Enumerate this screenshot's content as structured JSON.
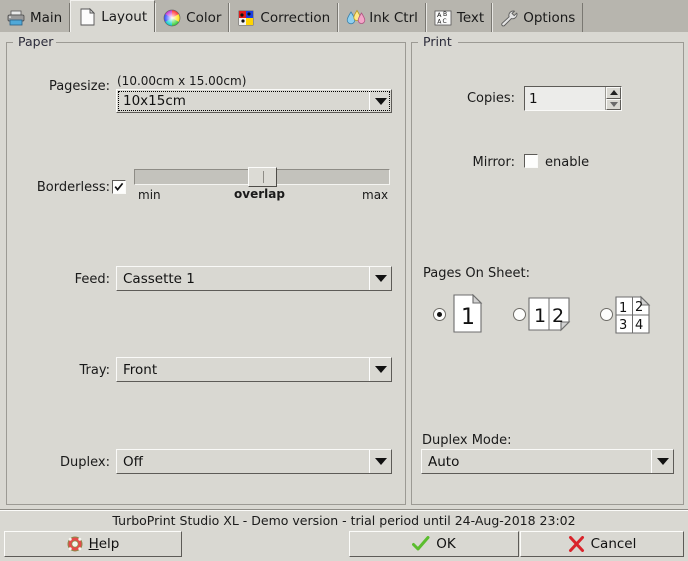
{
  "window": {
    "status_text": "TurboPrint Studio XL - Demo version - trial period until 24-Aug-2018 23:02"
  },
  "tabs": [
    {
      "label": "Main",
      "icon": "printer-icon",
      "active": false
    },
    {
      "label": "Layout",
      "icon": "page-icon",
      "active": true
    },
    {
      "label": "Color",
      "icon": "color-wheel-icon",
      "active": false
    },
    {
      "label": "Correction",
      "icon": "correction-icon",
      "active": false
    },
    {
      "label": "Ink Ctrl",
      "icon": "ink-drops-icon",
      "active": false
    },
    {
      "label": "Text",
      "icon": "abc-text-icon",
      "active": false
    },
    {
      "label": "Options",
      "icon": "wrench-icon",
      "active": false
    }
  ],
  "paper": {
    "title": "Paper",
    "pagesize": {
      "label": "Pagesize:",
      "dimensions": "(10.00cm x 15.00cm)",
      "value": "10x15cm"
    },
    "borderless": {
      "label": "Borderless:",
      "checked": true,
      "slider": {
        "min_label": "min",
        "center_label": "overlap",
        "max_label": "max",
        "position_percent": 50
      }
    },
    "feed": {
      "label": "Feed:",
      "value": "Cassette 1"
    },
    "tray": {
      "label": "Tray:",
      "value": "Front"
    },
    "duplex": {
      "label": "Duplex:",
      "value": "Off"
    }
  },
  "print": {
    "title": "Print",
    "copies": {
      "label": "Copies:",
      "value": "1"
    },
    "mirror": {
      "label": "Mirror:",
      "checkbox_label": "enable",
      "checked": false
    },
    "pages_on_sheet": {
      "label": "Pages On Sheet:",
      "options": [
        {
          "icon": "page-1up-icon",
          "selected": true,
          "numbers": [
            "1"
          ]
        },
        {
          "icon": "page-2up-icon",
          "selected": false,
          "numbers": [
            "1",
            "2"
          ]
        },
        {
          "icon": "page-4up-icon",
          "selected": false,
          "numbers": [
            "1",
            "2",
            "3",
            "4"
          ]
        }
      ]
    },
    "duplex_mode": {
      "label": "Duplex Mode:",
      "value": "Auto"
    }
  },
  "buttons": {
    "help": {
      "label_pre": "",
      "label_underline": "H",
      "label_post": "elp",
      "icon": "lifering-icon"
    },
    "ok": {
      "label": "OK",
      "icon": "check-icon"
    },
    "cancel": {
      "label": "Cancel",
      "icon": "cross-icon"
    }
  },
  "colors": {
    "face": "#d9d8d2",
    "tabbar": "#b7b5ae",
    "border_dark": "#5d5b57",
    "border_light": "#fcfcfa",
    "ok_green": "#5bbd2e",
    "cancel_red": "#d9242b"
  }
}
